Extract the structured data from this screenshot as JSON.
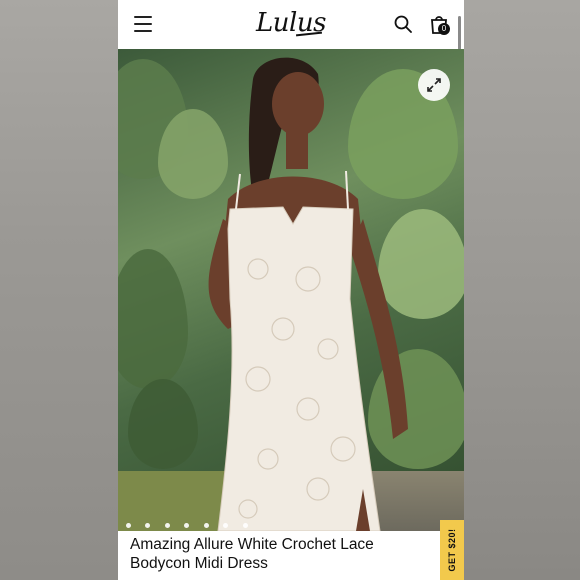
{
  "header": {
    "logo": "Lulus",
    "cart_count": "0"
  },
  "hero": {
    "carousel_dots": 7,
    "active_dot": 0
  },
  "product": {
    "title_line1": "Amazing Allure White Crochet Lace",
    "title_line2": "Bodycon Midi Dress"
  },
  "promo": {
    "label": "GET $20!"
  },
  "colors": {
    "promo": "#f2c94c",
    "text": "#111111"
  }
}
